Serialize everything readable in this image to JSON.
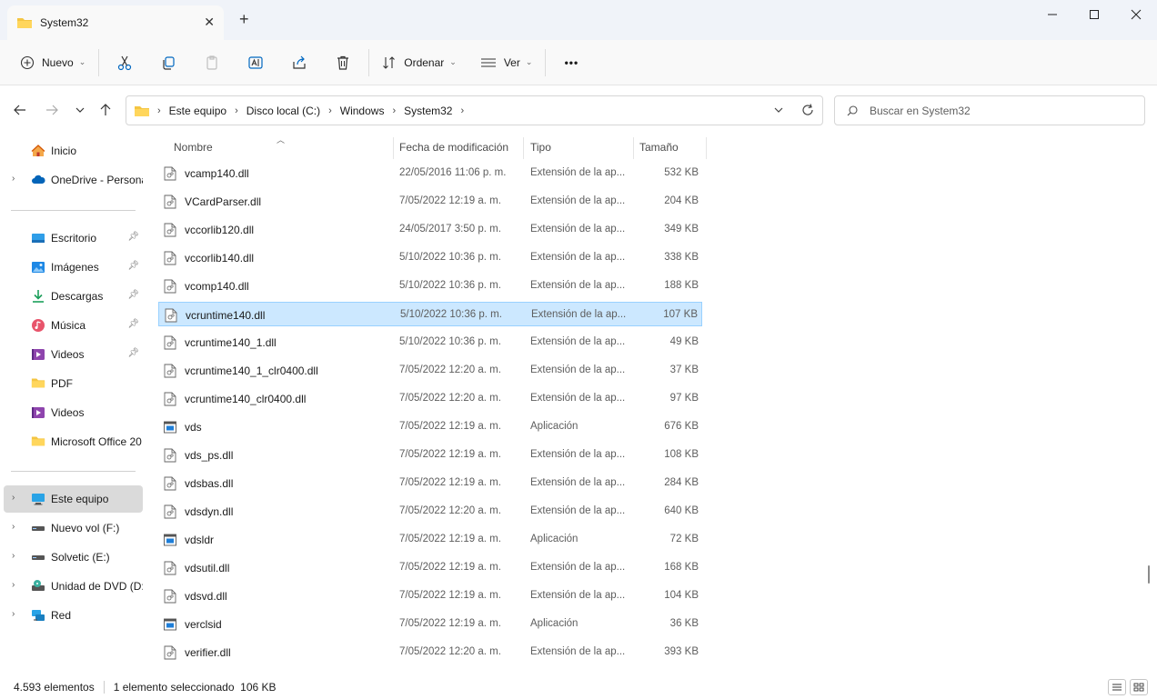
{
  "tab": {
    "title": "System32",
    "close": "✕",
    "add": "+"
  },
  "window": {
    "minimize": "—",
    "maximize": "☐",
    "close": "✕"
  },
  "toolbar": {
    "new_label": "Nuevo",
    "sort_label": "Ordenar",
    "view_label": "Ver",
    "more_label": "•••"
  },
  "address": {
    "crumbs": [
      "Este equipo",
      "Disco local (C:)",
      "Windows",
      "System32"
    ],
    "search_placeholder": "Buscar en System32"
  },
  "sidebar": {
    "top": [
      {
        "label": "Inicio",
        "icon": "home-icon",
        "chevron": false
      },
      {
        "label": "OneDrive - Persona",
        "icon": "cloud-icon",
        "chevron": true
      }
    ],
    "quick": [
      {
        "label": "Escritorio",
        "icon": "desktop-icon",
        "pinned": true
      },
      {
        "label": "Imágenes",
        "icon": "pictures-icon",
        "pinned": true
      },
      {
        "label": "Descargas",
        "icon": "download-icon",
        "pinned": true
      },
      {
        "label": "Música",
        "icon": "music-icon",
        "pinned": true
      },
      {
        "label": "Videos",
        "icon": "video-icon",
        "pinned": true
      },
      {
        "label": "PDF",
        "icon": "folder-icon",
        "pinned": false
      },
      {
        "label": "Videos",
        "icon": "video-icon",
        "pinned": false
      },
      {
        "label": "Microsoft Office 20",
        "icon": "folder-icon",
        "pinned": false
      }
    ],
    "devices": [
      {
        "label": "Este equipo",
        "icon": "pc-icon",
        "selected": true
      },
      {
        "label": "Nuevo vol (F:)",
        "icon": "drive-icon"
      },
      {
        "label": "Solvetic (E:)",
        "icon": "drive-icon"
      },
      {
        "label": "Unidad de DVD (D:)",
        "icon": "dvd-icon"
      },
      {
        "label": "Red",
        "icon": "network-icon"
      }
    ]
  },
  "columns": {
    "name": "Nombre",
    "date": "Fecha de modificación",
    "type": "Tipo",
    "size": "Tamaño"
  },
  "files": [
    {
      "name": "vcamp140.dll",
      "date": "22/05/2016 11:06 p. m.",
      "type": "Extensión de la ap...",
      "size": "532 KB",
      "kind": "dll"
    },
    {
      "name": "VCardParser.dll",
      "date": "7/05/2022 12:19 a. m.",
      "type": "Extensión de la ap...",
      "size": "204 KB",
      "kind": "dll"
    },
    {
      "name": "vccorlib120.dll",
      "date": "24/05/2017 3:50 p. m.",
      "type": "Extensión de la ap...",
      "size": "349 KB",
      "kind": "dll"
    },
    {
      "name": "vccorlib140.dll",
      "date": "5/10/2022 10:36 p. m.",
      "type": "Extensión de la ap...",
      "size": "338 KB",
      "kind": "dll"
    },
    {
      "name": "vcomp140.dll",
      "date": "5/10/2022 10:36 p. m.",
      "type": "Extensión de la ap...",
      "size": "188 KB",
      "kind": "dll"
    },
    {
      "name": "vcruntime140.dll",
      "date": "5/10/2022 10:36 p. m.",
      "type": "Extensión de la ap...",
      "size": "107 KB",
      "kind": "dll",
      "selected": true
    },
    {
      "name": "vcruntime140_1.dll",
      "date": "5/10/2022 10:36 p. m.",
      "type": "Extensión de la ap...",
      "size": "49 KB",
      "kind": "dll"
    },
    {
      "name": "vcruntime140_1_clr0400.dll",
      "date": "7/05/2022 12:20 a. m.",
      "type": "Extensión de la ap...",
      "size": "37 KB",
      "kind": "dll"
    },
    {
      "name": "vcruntime140_clr0400.dll",
      "date": "7/05/2022 12:20 a. m.",
      "type": "Extensión de la ap...",
      "size": "97 KB",
      "kind": "dll"
    },
    {
      "name": "vds",
      "date": "7/05/2022 12:19 a. m.",
      "type": "Aplicación",
      "size": "676 KB",
      "kind": "exe"
    },
    {
      "name": "vds_ps.dll",
      "date": "7/05/2022 12:19 a. m.",
      "type": "Extensión de la ap...",
      "size": "108 KB",
      "kind": "dll"
    },
    {
      "name": "vdsbas.dll",
      "date": "7/05/2022 12:19 a. m.",
      "type": "Extensión de la ap...",
      "size": "284 KB",
      "kind": "dll"
    },
    {
      "name": "vdsdyn.dll",
      "date": "7/05/2022 12:20 a. m.",
      "type": "Extensión de la ap...",
      "size": "640 KB",
      "kind": "dll"
    },
    {
      "name": "vdsldr",
      "date": "7/05/2022 12:19 a. m.",
      "type": "Aplicación",
      "size": "72 KB",
      "kind": "exe"
    },
    {
      "name": "vdsutil.dll",
      "date": "7/05/2022 12:19 a. m.",
      "type": "Extensión de la ap...",
      "size": "168 KB",
      "kind": "dll"
    },
    {
      "name": "vdsvd.dll",
      "date": "7/05/2022 12:19 a. m.",
      "type": "Extensión de la ap...",
      "size": "104 KB",
      "kind": "dll"
    },
    {
      "name": "verclsid",
      "date": "7/05/2022 12:19 a. m.",
      "type": "Aplicación",
      "size": "36 KB",
      "kind": "exe"
    },
    {
      "name": "verifier.dll",
      "date": "7/05/2022 12:20 a. m.",
      "type": "Extensión de la ap...",
      "size": "393 KB",
      "kind": "dll"
    }
  ],
  "status": {
    "count": "4.593 elementos",
    "selection": "1 elemento seleccionado  106 KB"
  },
  "colors": {
    "selected_row": "#cce8ff",
    "selected_border": "#99d1ff",
    "folder": "#f4c542",
    "accent": "#0067c0"
  }
}
